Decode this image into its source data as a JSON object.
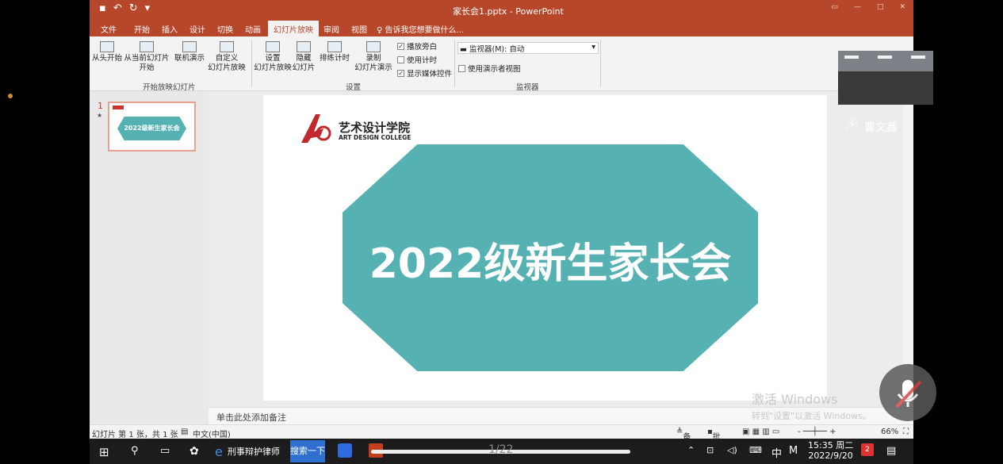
{
  "app": {
    "title": "家长会1.pptx - PowerPoint"
  },
  "tabs": [
    "文件",
    "开始",
    "插入",
    "设计",
    "切换",
    "动画",
    "幻灯片放映",
    "审阅",
    "视图"
  ],
  "tell_me": "告诉我您想要做什么...",
  "ribbon": {
    "from_beginning": "从头开始",
    "from_current": "从当前幻灯片",
    "from_current2": "开始",
    "online": "联机演示",
    "custom": "自定义",
    "custom2": "幻灯片放映",
    "group1": "开始放映幻灯片",
    "setup": "设置",
    "setup2": "幻灯片放映",
    "hide": "隐藏",
    "hide2": "幻灯片",
    "rehearse": "排练计时",
    "record": "录制",
    "record2": "幻灯片演示",
    "narration": "播放旁白",
    "timings": "使用计时",
    "media": "显示媒体控件",
    "group2": "设置",
    "monitor": "监视器(M): 自动",
    "presenter": "使用演示者视图",
    "group3": "监视器"
  },
  "thumb": {
    "number": "1",
    "star": "★",
    "title": "2022级新生家长会"
  },
  "slide": {
    "title": "2022级新生家长会",
    "logo_cn": "艺术设计学院",
    "logo_en": "ART DESIGN COLLEGE"
  },
  "notes": "单击此处添加备注",
  "status": {
    "slide_info": "幻灯片 第 1 张，共 1 张",
    "language": "中文(中国)",
    "notes": "备注",
    "comments": "批注",
    "zoom": "66%"
  },
  "watermark": {
    "line1": "激活 Windows",
    "line2": "转到\"设置\"以激活 Windows。"
  },
  "meeting": {
    "participant": "曹文鑫"
  },
  "taskbar": {
    "app_label": "刑事辩护律师",
    "search_label": "搜索一下",
    "page_counter": "1/22",
    "time": "15:35 周二",
    "date": "2022/9/20",
    "ime": "中",
    "notif": "2"
  },
  "colors": {
    "accent": "#b7472a",
    "hex_fill": "#56b1b3"
  }
}
